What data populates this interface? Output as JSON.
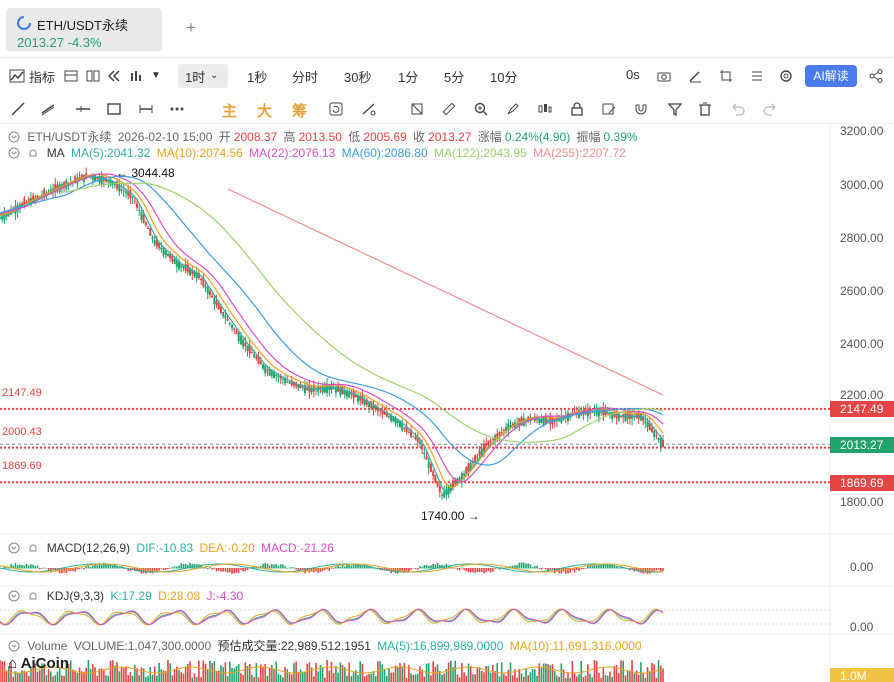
{
  "tab": {
    "title": "ETH/USDT永续",
    "price": "2013.27",
    "change": "-4.3%",
    "add": "+"
  },
  "toolbar1": {
    "indicators": "指标",
    "timeframes": [
      "1时",
      "1秒",
      "分时",
      "30秒",
      "1分",
      "5分",
      "10分"
    ],
    "countdown": "0s",
    "ai": "AI解读"
  },
  "toolbar2": {
    "labels": [
      "主",
      "大",
      "筹"
    ]
  },
  "info": {
    "line1": {
      "symbol": "ETH/USDT永续",
      "time": "2026-02-10 15:00",
      "open_l": "开",
      "open": "2008.37",
      "high_l": "高",
      "high": "2013.50",
      "low_l": "低",
      "low": "2005.69",
      "close_l": "收",
      "close": "2013.27",
      "chg_l": "涨幅",
      "chg": "0.24%(4.90)",
      "amp_l": "振幅",
      "amp": "0.39%"
    },
    "ma": {
      "label": "MA",
      "ma5": "MA(5):2041.32",
      "ma10": "MA(10):2074.56",
      "ma22": "MA(22):2076.13",
      "ma60": "MA(60):2086.80",
      "ma122": "MA(122):2043.95",
      "ma255": "MA(255):2207.72"
    },
    "macd": {
      "label": "MACD(12,26,9)",
      "dif": "DIF:-10.83",
      "dea": "DEA:-0.20",
      "macd": "MACD:-21.26"
    },
    "kdj": {
      "label": "KDJ(9,3,3)",
      "k": "K:17.29",
      "d": "D:28.08",
      "j": "J:-4.30"
    },
    "volume": {
      "label": "Volume",
      "vol": "VOLUME:1,047,300.0000",
      "est": "预估成交量:22,989,512.1951",
      "ma5": "MA(5):16,899,989.0000",
      "ma10": "MA(10):11,691,316.0000"
    }
  },
  "yaxis": [
    "3200.00",
    "3000.00",
    "2800.00",
    "2600.00",
    "2400.00",
    "2200.00",
    "1800.00"
  ],
  "levels": {
    "l1": "2147.49",
    "l2": "2000.43",
    "l3": "1869.69"
  },
  "tags": {
    "t1": "2147.49",
    "t2": "2013.27",
    "t3": "1869.69",
    "vol": "1.0M"
  },
  "annotations": {
    "high": "3044.48",
    "low": "1740.00"
  },
  "sub_axis": {
    "macd_zero": "0.00",
    "kdj_zero": "0.00"
  },
  "brand": "AiCoin",
  "colors": {
    "up": "#21a36b",
    "down": "#e34444",
    "ma5": "#2eb0a4",
    "ma10": "#e8a320",
    "ma22": "#d84fc2",
    "ma60": "#3d9de0",
    "ma122": "#9fcf6f",
    "ma255": "#ef8f8f"
  },
  "chart_data": {
    "type": "line",
    "title": "",
    "ylim": [
      1700,
      3250
    ],
    "x": [
      0,
      10,
      20,
      30,
      40,
      50,
      60,
      70,
      80,
      90,
      100,
      110,
      120,
      130,
      140,
      150,
      160,
      170,
      180,
      190,
      200,
      210,
      220,
      230,
      240,
      250,
      260,
      270,
      280,
      290,
      300
    ],
    "series": [
      {
        "values": [
          2870,
          2920,
          2960,
          3000,
          3030,
          3010,
          2950,
          2780,
          2700,
          2650,
          2520,
          2400,
          2300,
          2250,
          2220,
          2230,
          2200,
          2150,
          2100,
          2020,
          1820,
          1900,
          2010,
          2080,
          2110,
          2100,
          2130,
          2140,
          2120,
          2120,
          2013
        ]
      }
    ]
  }
}
